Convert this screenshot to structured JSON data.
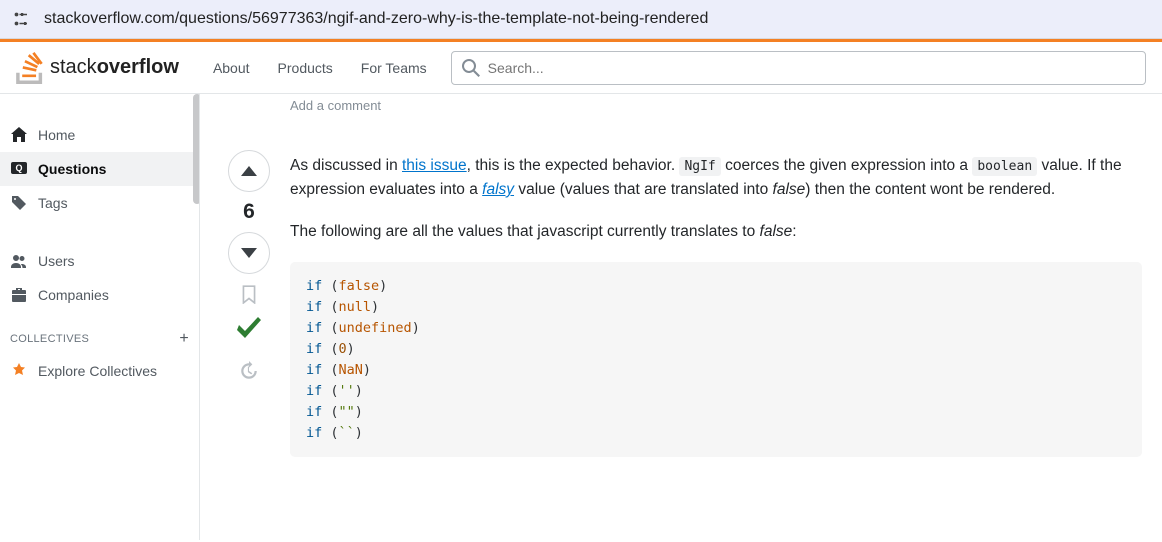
{
  "browser": {
    "url": "stackoverflow.com/questions/56977363/ngif-and-zero-why-is-the-template-not-being-rendered"
  },
  "header": {
    "logo_a": "stack",
    "logo_b": "overflow",
    "nav": {
      "about": "About",
      "products": "Products",
      "forteams": "For Teams"
    },
    "search_placeholder": "Search..."
  },
  "sidebar": {
    "home": "Home",
    "questions": "Questions",
    "tags": "Tags",
    "users": "Users",
    "companies": "Companies",
    "collectives_heading": "COLLECTIVES",
    "explore": "Explore Collectives"
  },
  "content": {
    "add_comment": "Add a comment",
    "score": "6",
    "para1_a": "As discussed in ",
    "para1_link": "this issue",
    "para1_b": ", this is the expected behavior. ",
    "code_ngif": "NgIf",
    "para1_c": " coerces the given expression into a ",
    "code_boolean": "boolean",
    "para1_d": " value. If the expression evaluates into a ",
    "link_falsy": "falsy",
    "para1_e": " value (values that are translated into ",
    "word_false": "false",
    "para1_f": ") then the content wont be rendered.",
    "para2_a": "The following are all the values that javascript currently translates to ",
    "para2_false": "false",
    "para2_b": ":",
    "code": {
      "l1k": "if",
      "l1l": "false",
      "l2k": "if",
      "l2l": "null",
      "l3k": "if",
      "l3l": "undefined",
      "l4k": "if",
      "l4l": "0",
      "l5k": "if",
      "l5l": "NaN",
      "l6k": "if",
      "l6l": "''",
      "l7k": "if",
      "l7l": "\"\"",
      "l8k": "if",
      "l8l": "``"
    }
  }
}
